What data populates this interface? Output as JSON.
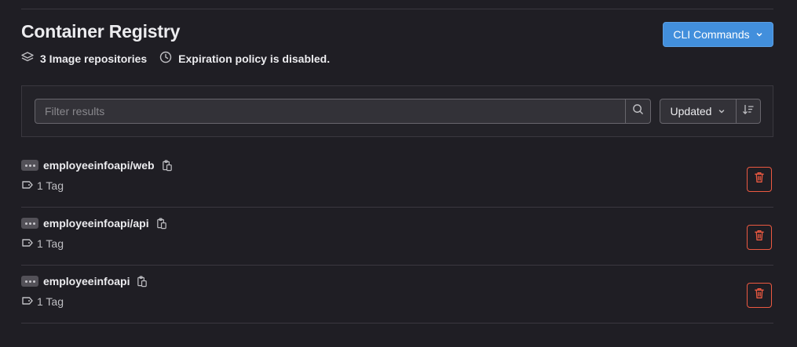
{
  "header": {
    "title": "Container Registry",
    "repo_count": "3 Image repositories",
    "expiration_text": "Expiration policy is disabled.",
    "cli_button": "CLI Commands"
  },
  "filter": {
    "placeholder": "Filter results",
    "sort_label": "Updated"
  },
  "repositories": [
    {
      "name": "employeeinfoapi/web",
      "tags": "1 Tag"
    },
    {
      "name": "employeeinfoapi/api",
      "tags": "1 Tag"
    },
    {
      "name": "employeeinfoapi",
      "tags": "1 Tag"
    }
  ],
  "colors": {
    "background": "#1f1e24",
    "accent": "#428fdc",
    "danger": "#ec5941",
    "border": "#3a383f"
  },
  "icons": [
    "layers-icon",
    "clock-icon",
    "chevron-down-icon",
    "search-icon",
    "sort-direction-icon",
    "ellipsis-icon",
    "copy-icon",
    "label-icon",
    "trash-icon"
  ]
}
